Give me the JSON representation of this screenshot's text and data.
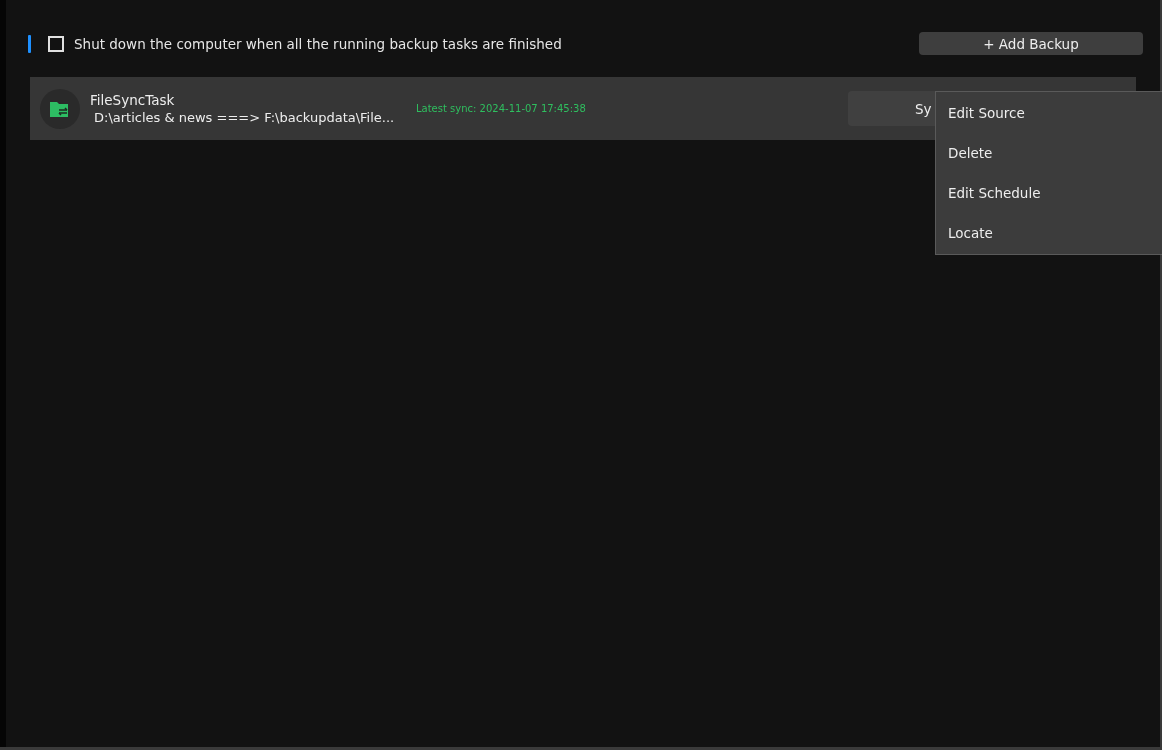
{
  "shutdown_option": {
    "label": "Shut down the computer when all the running backup tasks are finished",
    "checked": false
  },
  "add_button": {
    "label": "+ Add Backup"
  },
  "tasks": [
    {
      "name": "FileSyncTask",
      "path": "D:\\articles & news ===> F:\\backupdata\\File...",
      "latest_sync": "Latest sync: 2024-11-07 17:45:38",
      "button": "Sy"
    }
  ],
  "context_menu": {
    "items": [
      "Edit Source",
      "Delete",
      "Edit Schedule",
      "Locate"
    ]
  }
}
